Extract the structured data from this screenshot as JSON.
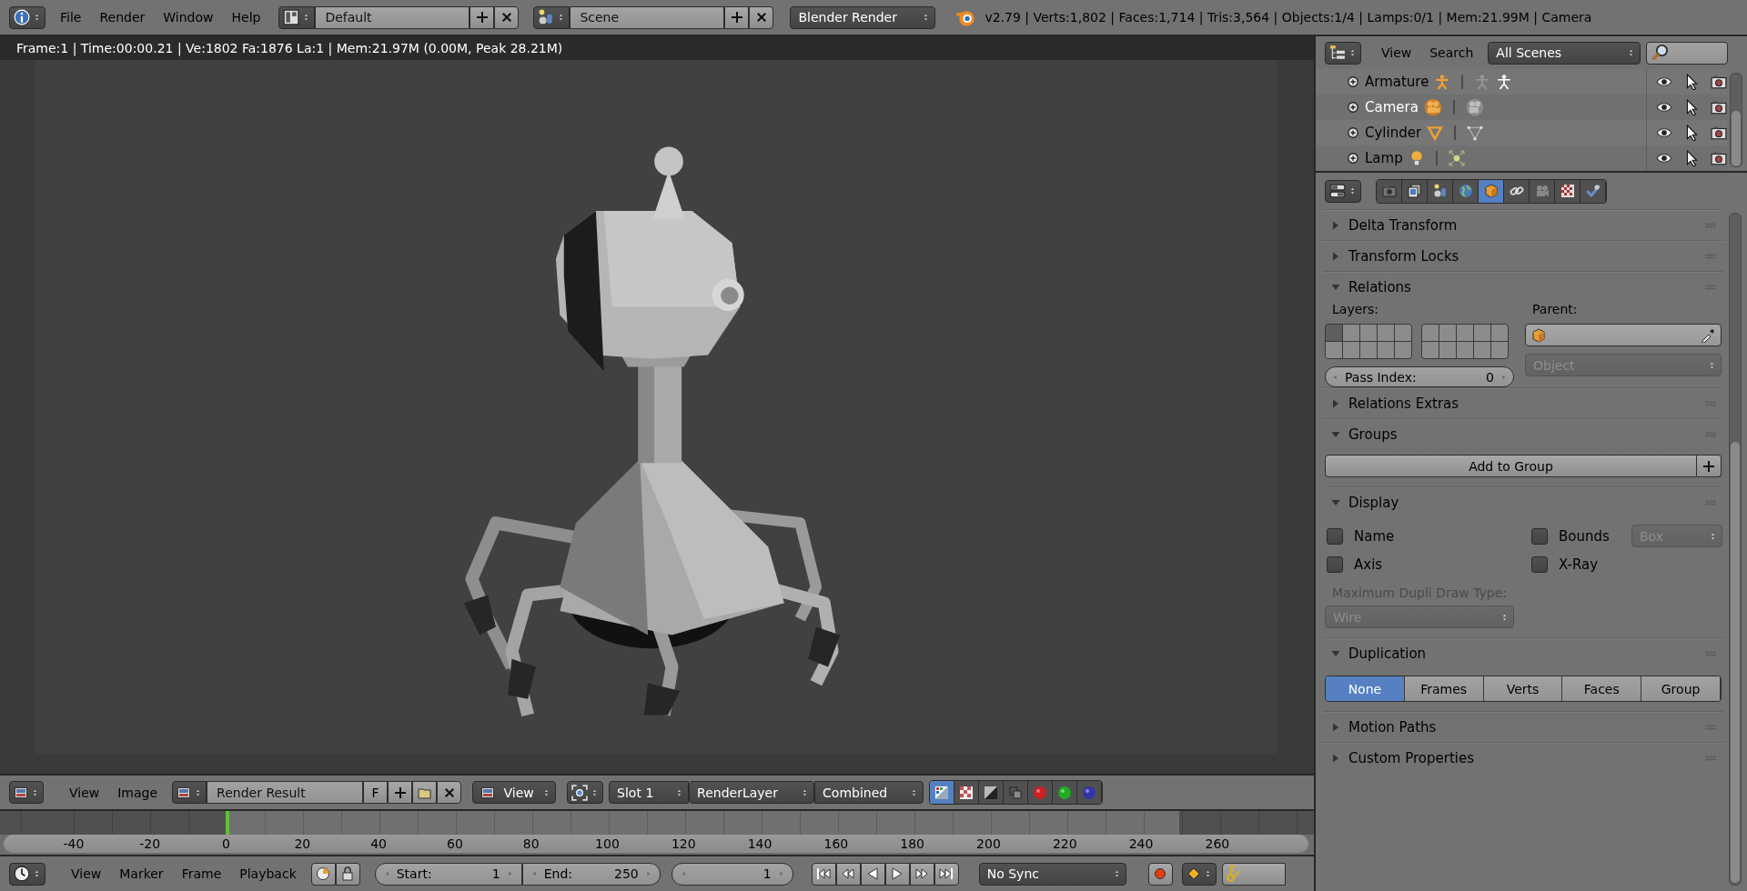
{
  "top_bar": {
    "menus": [
      "File",
      "Render",
      "Window",
      "Help"
    ],
    "screen_layout": "Default",
    "scene": "Scene",
    "render_engine": "Blender Render",
    "stats": "v2.79 | Verts:1,802 | Faces:1,714 | Tris:3,564 | Objects:1/4 | Lamps:0/1 | Mem:21.99M | Camera"
  },
  "image_editor": {
    "render_info": "Frame:1 | Time:00:00.21 | Ve:1802 Fa:1876 La:1 | Mem:21.97M (0.00M, Peak 28.21M)",
    "header": {
      "menus": [
        "View",
        "Image"
      ],
      "image": "Render Result",
      "fake_user": "F",
      "view": "View",
      "slot": "Slot 1",
      "render_layer": "RenderLayer",
      "render_pass": "Combined",
      "display_modes": [
        {
          "kind": "color_alpha",
          "selected": true
        },
        {
          "kind": "alpha",
          "selected": false
        },
        {
          "kind": "z_buffer",
          "selected": false
        },
        {
          "kind": "overlay",
          "selected": false
        },
        {
          "kind": "red",
          "selected": false
        },
        {
          "kind": "green",
          "selected": false
        },
        {
          "kind": "blue",
          "selected": false
        }
      ]
    }
  },
  "timeline": {
    "ruler_ticks": [
      "-40",
      "-20",
      "0",
      "20",
      "40",
      "60",
      "80",
      "100",
      "120",
      "140",
      "160",
      "180",
      "200",
      "220",
      "240",
      "260"
    ],
    "playhead": {
      "level": 0.173
    },
    "header": {
      "menus": [
        "View",
        "Marker",
        "Frame",
        "Playback"
      ],
      "start_label": "Start:",
      "start": "1",
      "end_label": "End:",
      "end": "250",
      "current_frame": "1",
      "sync": "No Sync"
    }
  },
  "outliner": {
    "menus": [
      "View",
      "Search"
    ],
    "display_mode": "All Scenes",
    "rows": [
      {
        "name": "Armature",
        "kind": "armature",
        "selected": false
      },
      {
        "name": "Camera",
        "kind": "camera",
        "selected": true
      },
      {
        "name": "Cylinder",
        "kind": "mesh",
        "selected": false
      },
      {
        "name": "Lamp",
        "kind": "lamp",
        "selected": false
      }
    ]
  },
  "properties": {
    "tabs": [
      {
        "kind": "render",
        "selected": false
      },
      {
        "kind": "render_layers",
        "selected": false
      },
      {
        "kind": "scene",
        "selected": false
      },
      {
        "kind": "world",
        "selected": false
      },
      {
        "kind": "object",
        "selected": true
      },
      {
        "kind": "constraints",
        "selected": false
      },
      {
        "kind": "data",
        "selected": false
      },
      {
        "kind": "texture",
        "selected": false
      },
      {
        "kind": "physics",
        "selected": false
      }
    ],
    "panels": [
      {
        "title": "Delta Transform",
        "expanded": false
      },
      {
        "title": "Transform Locks",
        "expanded": false
      },
      {
        "title": "Relations",
        "kind": "relations",
        "expanded": true,
        "layers_label": "Layers:",
        "layers": [
          {
            "selected": true
          },
          {
            "selected": false
          },
          {
            "selected": false
          },
          {
            "selected": false
          },
          {
            "selected": false
          },
          {
            "selected": false
          },
          {
            "selected": false
          },
          {
            "selected": false
          },
          {
            "selected": false
          },
          {
            "selected": false
          },
          {
            "selected": false
          },
          {
            "selected": false
          },
          {
            "selected": false
          },
          {
            "selected": false
          },
          {
            "selected": false
          },
          {
            "selected": false
          },
          {
            "selected": false
          },
          {
            "selected": false
          },
          {
            "selected": false
          },
          {
            "selected": false
          }
        ],
        "parent_label": "Parent:",
        "parent_type": {
          "value": "Object",
          "disabled": true
        },
        "pass_index_label": "Pass Index:",
        "pass_index": "0"
      },
      {
        "title": "Relations Extras",
        "expanded": false
      },
      {
        "title": "Groups",
        "kind": "groups",
        "expanded": true,
        "button": "Add to Group"
      },
      {
        "title": "Display",
        "kind": "display",
        "expanded": true,
        "options": [
          {
            "label": "Name",
            "checked": false
          },
          {
            "label": "Bounds",
            "checked": false
          },
          {
            "label": "Axis",
            "checked": false
          },
          {
            "label": "X-Ray",
            "checked": false
          }
        ],
        "bounds_type": {
          "value": "Box",
          "disabled": true
        },
        "dupli_label": "Maximum Dupli Draw Type:",
        "dupli_type": {
          "value": "Wire",
          "disabled": true
        }
      },
      {
        "title": "Duplication",
        "kind": "duplication",
        "expanded": true,
        "options": [
          {
            "label": "None",
            "selected": true
          },
          {
            "label": "Frames",
            "selected": false
          },
          {
            "label": "Verts",
            "selected": false
          },
          {
            "label": "Faces",
            "selected": false
          },
          {
            "label": "Group",
            "selected": false
          }
        ]
      },
      {
        "title": "Motion Paths",
        "expanded": false
      },
      {
        "title": "Custom Properties",
        "expanded": false
      }
    ]
  }
}
